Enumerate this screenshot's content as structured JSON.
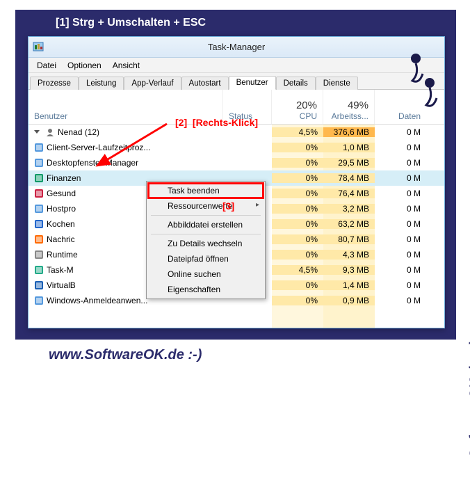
{
  "annotation_top": "[1]  Strg + Umschalten + ESC",
  "watermark": "www.SoftwareOK.de :-)",
  "window": {
    "title": "Task-Manager",
    "menu": [
      "Datei",
      "Optionen",
      "Ansicht"
    ],
    "tabs": [
      "Prozesse",
      "Leistung",
      "App-Verlauf",
      "Autostart",
      "Benutzer",
      "Details",
      "Dienste"
    ],
    "active_tab": 4,
    "columns": {
      "user": "Benutzer",
      "status": "Status",
      "cpu_pct": "20%",
      "cpu_label": "CPU",
      "mem_pct": "49%",
      "mem_label": "Arbeitss...",
      "net_label": "Daten"
    },
    "user_row": {
      "name": "Nenad (12)",
      "cpu": "4,5%",
      "mem": "376,6 MB",
      "net": "0 M"
    },
    "processes": [
      {
        "name": "Client-Server-Laufzeitproz...",
        "cpu": "0%",
        "mem": "1,0 MB",
        "net": "0 M",
        "icon": "window"
      },
      {
        "name": "Desktopfenster-Manager",
        "cpu": "0%",
        "mem": "29,5 MB",
        "net": "0 M",
        "icon": "window"
      },
      {
        "name": "Finanzen",
        "cpu": "0%",
        "mem": "78,4 MB",
        "net": "0 M",
        "icon": "finance",
        "selected": true
      },
      {
        "name": "Gesund",
        "cpu": "0%",
        "mem": "76,4 MB",
        "net": "0 M",
        "icon": "health"
      },
      {
        "name": "Hostpro",
        "cpu": "0%",
        "mem": "3,2 MB",
        "net": "0 M",
        "icon": "window"
      },
      {
        "name": "Kochen",
        "cpu": "0%",
        "mem": "63,2 MB",
        "net": "0 M",
        "icon": "food"
      },
      {
        "name": "Nachric",
        "cpu": "0%",
        "mem": "80,7 MB",
        "net": "0 M",
        "icon": "news"
      },
      {
        "name": "Runtime",
        "cpu": "0%",
        "mem": "4,3 MB",
        "net": "0 M",
        "icon": "gear"
      },
      {
        "name": "Task-M",
        "cpu": "4,5%",
        "mem": "9,3 MB",
        "net": "0 M",
        "icon": "taskmgr"
      },
      {
        "name": "VirtualB",
        "cpu": "0%",
        "mem": "1,4 MB",
        "net": "0 M",
        "icon": "vbox"
      },
      {
        "name": "Windows-Anmeldeanwen...",
        "cpu": "0%",
        "mem": "0,9 MB",
        "net": "0 M",
        "icon": "window"
      }
    ],
    "context_menu": [
      "Task beenden",
      "Ressourcenwerte",
      "Abbilddatei erstellen",
      "Zu Details wechseln",
      "Dateipfad öffnen",
      "Online suchen",
      "Eigenschaften"
    ]
  },
  "annotation_2": "[2]",
  "annotation_2_text": "[Rechts-Klick]",
  "annotation_3": "[3]"
}
